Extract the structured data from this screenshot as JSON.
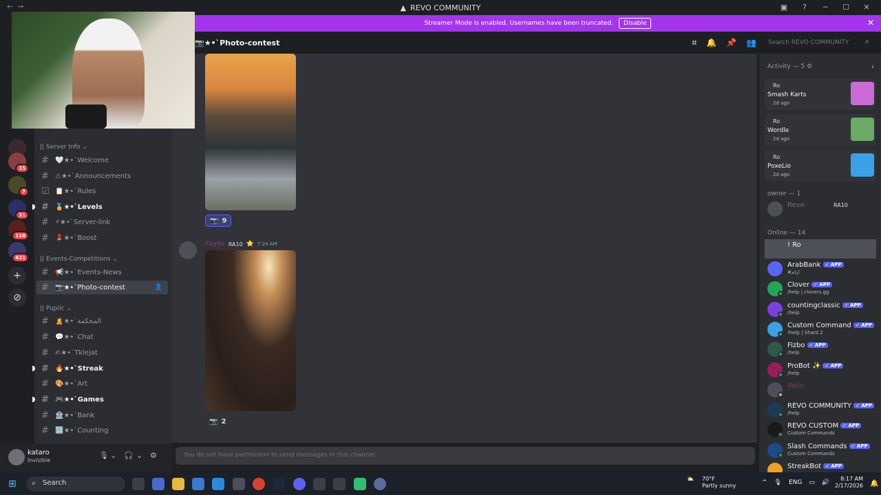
{
  "app": {
    "title": "REVO COMMUNITY"
  },
  "banner": {
    "text": "Streamer Mode is enabled. Usernames have been truncated.",
    "disable_label": "Disable"
  },
  "servers": {
    "badges": [
      "15",
      "7",
      "31",
      "118",
      "621"
    ]
  },
  "channels": {
    "categories": [
      "|| Server Info",
      "|| Events-Competitions",
      "|| Puplic"
    ],
    "items": [
      {
        "label": "🤍★•ˋWelcome"
      },
      {
        "label": "⚠★•ˋAnnouncements"
      },
      {
        "label": "📋★•ˋRules"
      },
      {
        "label": "🏅★•ˋLevels"
      },
      {
        "label": "⚡★•ˋServer-link"
      },
      {
        "label": "💄★•ˋBoost"
      },
      {
        "label": "📢★•ˋEvents-News"
      },
      {
        "label": "📷★•ˋPhoto-contest"
      },
      {
        "label": "🙎★•ˋالمحكمة"
      },
      {
        "label": "💬★•ˋChat"
      },
      {
        "label": "✍★•ˋTklejat"
      },
      {
        "label": "🔥★•ˋStreak"
      },
      {
        "label": "🎨★•ˋArt"
      },
      {
        "label": "🎮★•ˋGames"
      },
      {
        "label": "🏦★•ˋBank"
      },
      {
        "label": "🔢★•ˋCounting"
      }
    ]
  },
  "user": {
    "name": "kataro",
    "status": "Invisible"
  },
  "header": {
    "channel": "📷★•ˋPhoto-contest",
    "search_placeholder": "Search REVO COMMUNITY"
  },
  "messages": {
    "reaction1": "9",
    "reaction2": "2",
    "author": "Fay6z",
    "author_tag": "RA10",
    "time": "7:24 AM",
    "no_permission": "You do not have permission to send messages in this channel."
  },
  "members": {
    "activity_header": "Activity — 5",
    "activities": [
      {
        "user": "Ro",
        "game": "Smash Karts",
        "time": "2d ago",
        "color": "#c86bd4"
      },
      {
        "user": "Ro",
        "game": "Wordle",
        "time": "2d ago",
        "color": "#6aaa64"
      },
      {
        "user": "Ro",
        "game": "PoxeLio",
        "time": "2d ago",
        "color": "#3aa0e8"
      }
    ],
    "owner_header": "owner — 1",
    "owner": {
      "name": "Reve",
      "tag": "RA10"
    },
    "online_header": "Online — 14",
    "online": [
      {
        "name": "! Ro",
        "sub": "",
        "app": false,
        "color": "#f2f3f5"
      },
      {
        "name": "ArabBank",
        "sub": "#ارام",
        "app": true,
        "color": "#f2f3f5"
      },
      {
        "name": "Clover",
        "sub": "/help | clovers.gg",
        "app": true,
        "color": "#f2f3f5"
      },
      {
        "name": "countingclassic",
        "sub": "/help",
        "app": true,
        "color": "#f2f3f5"
      },
      {
        "name": "Custom Command",
        "sub": "!help | Shard 2",
        "app": true,
        "color": "#f2f3f5"
      },
      {
        "name": "Fizbo",
        "sub": "/help",
        "app": true,
        "color": "#f2f3f5"
      },
      {
        "name": "ProBot ✨",
        "sub": "/help",
        "app": true,
        "color": "#f2f3f5"
      },
      {
        "name": "Relin",
        "sub": "",
        "app": false,
        "color": "#7a3d5c"
      },
      {
        "name": "REVO COMMUNITY",
        "sub": "/help",
        "app": true,
        "color": "#f2f3f5"
      },
      {
        "name": "REVO CUSTOM",
        "sub": "Custom Commands",
        "app": true,
        "color": "#f2f3f5"
      },
      {
        "name": "Slash Commands",
        "sub": "Custom Commands",
        "app": true,
        "color": "#f2f3f5"
      },
      {
        "name": "StreakBot",
        "sub": "",
        "app": true,
        "color": "#f2f3f5"
      }
    ],
    "app_label": "✓ APP"
  },
  "taskbar": {
    "search_label": "Search",
    "weather_temp": "70°F",
    "weather_desc": "Partly sunny",
    "lang": "ENG",
    "time": "8:17 AM",
    "date": "2/17/2026"
  }
}
